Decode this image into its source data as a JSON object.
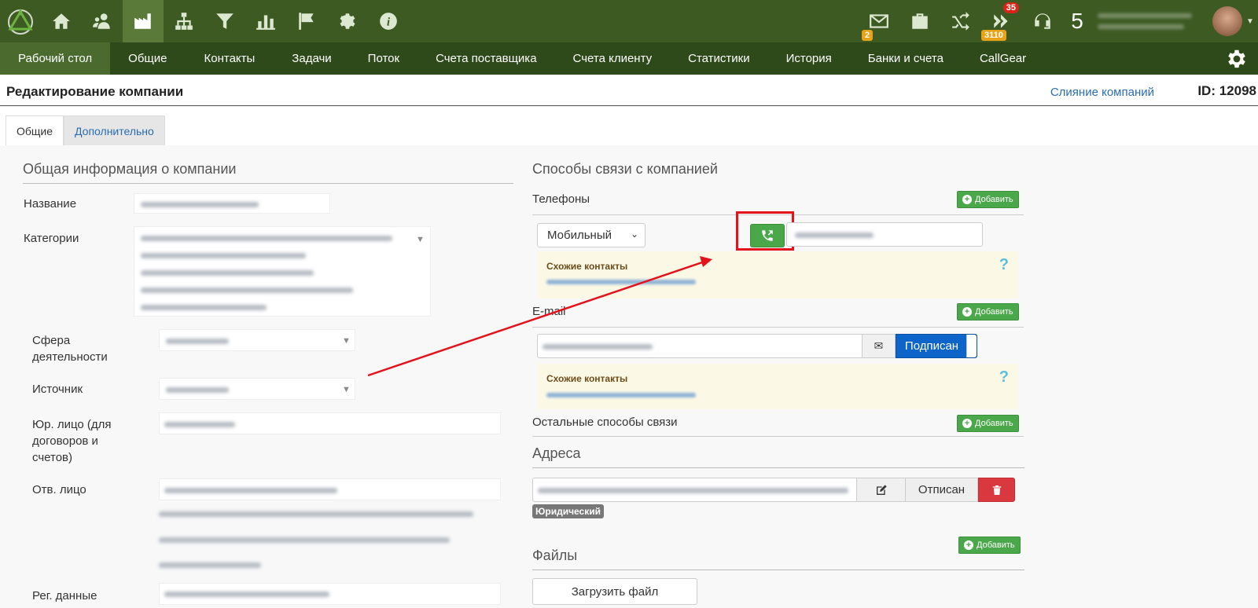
{
  "topbar": {
    "icons": [
      "home-icon",
      "contacts-icon",
      "company-icon",
      "structure-icon",
      "filter-icon",
      "chart-icon",
      "flag-icon",
      "gear-icon",
      "info-icon"
    ],
    "mail_badge": "2",
    "flow_badge_top": "35",
    "flow_badge_bottom": "3110",
    "count": "5"
  },
  "nav": {
    "items": [
      "Рабочий стол",
      "Общие",
      "Контакты",
      "Задачи",
      "Поток",
      "Счета поставщика",
      "Счета клиенту",
      "Статистики",
      "История",
      "Банки и счета",
      "CallGear"
    ]
  },
  "page": {
    "title": "Редактирование компании",
    "merge_link": "Слияние компаний",
    "id_label": "ID: 12098"
  },
  "tabs": [
    "Общие",
    "Дополнительно"
  ],
  "left": {
    "section_title": "Общая информация о компании",
    "fields": {
      "name": "Название",
      "categories": "Категории",
      "sphere": "Сфера деятельности",
      "source": "Источник",
      "legal": "Юр. лицо (для договоров и счетов)",
      "responsible": "Отв. лицо",
      "reg": "Рег. данные"
    }
  },
  "right": {
    "section_title": "Способы связи с компанией",
    "phones_label": "Телефоны",
    "add_label": "Добавить",
    "phone_type": "Мобильный",
    "similar_contacts": "Схожие контакты",
    "help": "?",
    "email_label": "E-mail",
    "subscribed": "Подписан",
    "other_label": "Остальные способы связи",
    "addresses_title": "Адреса",
    "unsubscribed": "Отписан",
    "legal_tag": "Юридический",
    "files_title": "Файлы",
    "upload": "Загрузить файл"
  },
  "colors": {
    "topbar": "#3d5a22",
    "nav": "#2f4a1a",
    "add_green": "#4aa84a",
    "subscribe_blue": "#0d64c9",
    "delete_red": "#d9393e",
    "highlight_red": "#e3121b"
  }
}
